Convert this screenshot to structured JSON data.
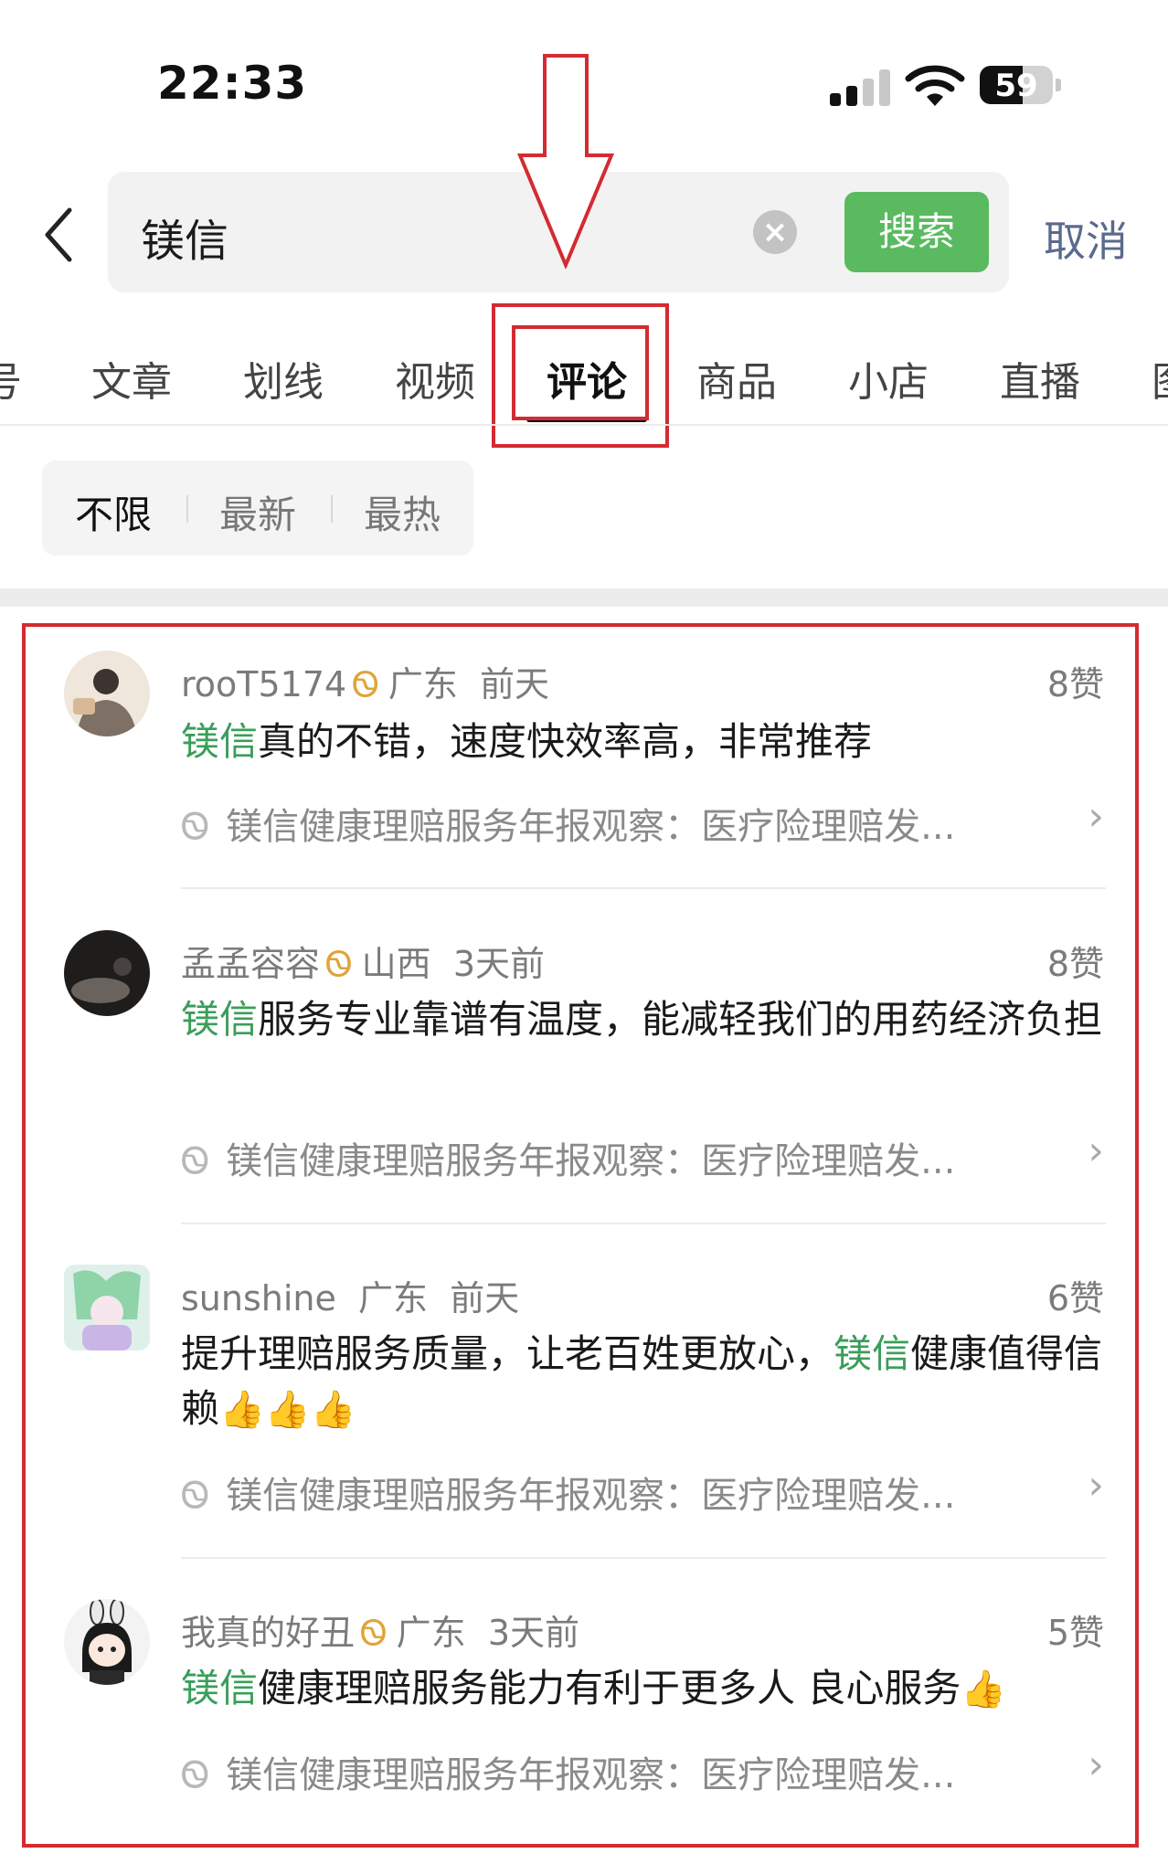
{
  "status_bar": {
    "time": "22:33",
    "battery": "59",
    "battery_level": 0.59
  },
  "search": {
    "query": "镁信",
    "button_label": "搜索",
    "cancel_label": "取消"
  },
  "tabs": [
    "号",
    "文章",
    "划线",
    "视频",
    "评论",
    "商品",
    "小店",
    "直播",
    "图"
  ],
  "active_tab": "评论",
  "filters": [
    "不限",
    "最新",
    "最热"
  ],
  "active_filter": "不限",
  "comments": [
    {
      "user": "rooT5174",
      "location": "广东",
      "time": "前天",
      "likes": "8赞",
      "keyword": "镁信",
      "text_after": "真的不错，速度快效率高，非常推荐",
      "source": "镁信健康理赔服务年报观察：医疗险理赔发..."
    },
    {
      "user": "孟孟容容",
      "location": "山西",
      "time": "3天前",
      "likes": "8赞",
      "keyword": "镁信",
      "text_after": "服务专业靠谱有温度，能减轻我们的用药经济负担",
      "source": "镁信健康理赔服务年报观察：医疗险理赔发..."
    },
    {
      "user": "sunshine",
      "location": "广东",
      "time": "前天",
      "likes": "6赞",
      "text_before": "提升理赔服务质量，让老百姓更放心，",
      "keyword": "镁信",
      "text_after": "健康值得信赖",
      "emoji": "👍👍👍",
      "source": "镁信健康理赔服务年报观察：医疗险理赔发..."
    },
    {
      "user": "我真的好丑",
      "location": "广东",
      "time": "3天前",
      "likes": "5赞",
      "keyword": "镁信",
      "text_after": "健康理赔服务能力有利于更多人 良心服务",
      "emoji": "👍",
      "source": "镁信健康理赔服务年报观察：医疗险理赔发..."
    }
  ],
  "colors": {
    "accent_green": "#5aba5f",
    "keyword_green": "#3a9e5a",
    "annotation_red": "#d32b32",
    "cancel_blue": "#5a6a8c"
  }
}
